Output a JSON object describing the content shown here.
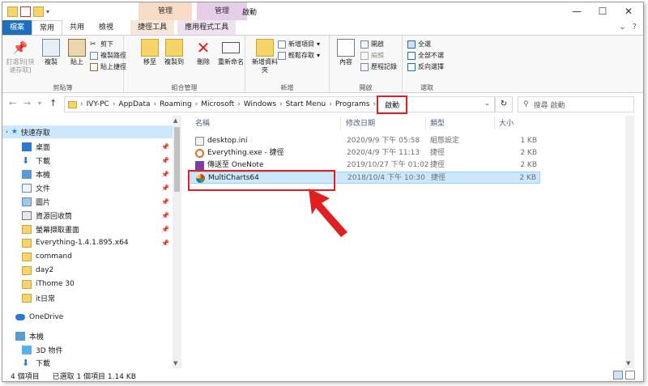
{
  "window": {
    "title": "啟動",
    "context_tab_1": "管理",
    "context_tab_2": "管理",
    "minimize": "—",
    "maximize": "☐",
    "close": "✕"
  },
  "ribbon_tabs": [
    "檔案",
    "常用",
    "共用",
    "檢視",
    "捷徑工具",
    "應用程式工具"
  ],
  "ribbon": {
    "clipboard": {
      "pin": "釘選到[快速存取]",
      "copy": "複製",
      "paste": "貼上",
      "cut": "剪下",
      "copy_path": "複製路徑",
      "paste_shortcut": "貼上捷徑",
      "label": "剪貼簿"
    },
    "organize": {
      "move_to": "移至",
      "copy_to": "複製到",
      "delete": "刪除",
      "rename": "重新命名",
      "label": "組合管理"
    },
    "new": {
      "new_folder": "新增資料夾",
      "new_item": "新增項目",
      "easy_access": "輕鬆存取",
      "label": "新增"
    },
    "open": {
      "properties": "內容",
      "open": "開啟",
      "edit": "編輯",
      "history": "歷程記錄",
      "label": "開啟"
    },
    "select": {
      "select_all": "全選",
      "select_none": "全部不選",
      "invert": "反向選擇",
      "label": "選取"
    }
  },
  "address": {
    "crumbs": [
      "IVY-PC",
      "AppData",
      "Roaming",
      "Microsoft",
      "Windows",
      "Start Menu",
      "Programs",
      "啟動"
    ],
    "search_placeholder": "搜尋 啟動"
  },
  "nav": {
    "items": [
      {
        "label": "快速存取",
        "pinned": false
      },
      {
        "label": "桌面",
        "pinned": true
      },
      {
        "label": "下載",
        "pinned": true
      },
      {
        "label": "本機",
        "pinned": true
      },
      {
        "label": "文件",
        "pinned": true
      },
      {
        "label": "圖片",
        "pinned": true
      },
      {
        "label": "資源回收筒",
        "pinned": true
      },
      {
        "label": "螢幕擷取畫面",
        "pinned": true
      },
      {
        "label": "Everything-1.4.1.895.x64",
        "pinned": true
      },
      {
        "label": "command",
        "pinned": false
      },
      {
        "label": "day2",
        "pinned": false
      },
      {
        "label": "iThome 30",
        "pinned": false
      },
      {
        "label": "it日常",
        "pinned": false
      },
      {
        "label": "OneDrive",
        "pinned": false
      },
      {
        "label": "本機",
        "pinned": false
      },
      {
        "label": "3D 物件",
        "pinned": false
      },
      {
        "label": "下載",
        "pinned": false
      }
    ]
  },
  "columns": {
    "name": "名稱",
    "date": "修改日期",
    "type": "類型",
    "size": "大小"
  },
  "files": [
    {
      "name": "desktop.ini",
      "date": "2020/9/9 下午 05:58",
      "type": "組態設定",
      "size": "1 KB"
    },
    {
      "name": "Everything.exe - 捷徑",
      "date": "2020/4/9 下午 11:13",
      "type": "捷徑",
      "size": "2 KB"
    },
    {
      "name": "傳送至 OneNote",
      "date": "2019/10/27 下午 01:02",
      "type": "捷徑",
      "size": "2 KB"
    },
    {
      "name": "MultiCharts64",
      "date": "2018/10/4 下午 10:30",
      "type": "捷徑",
      "size": "2 KB"
    }
  ],
  "status": {
    "count": "4 個項目",
    "selection": "已選取 1 個項目  1.14 KB"
  }
}
